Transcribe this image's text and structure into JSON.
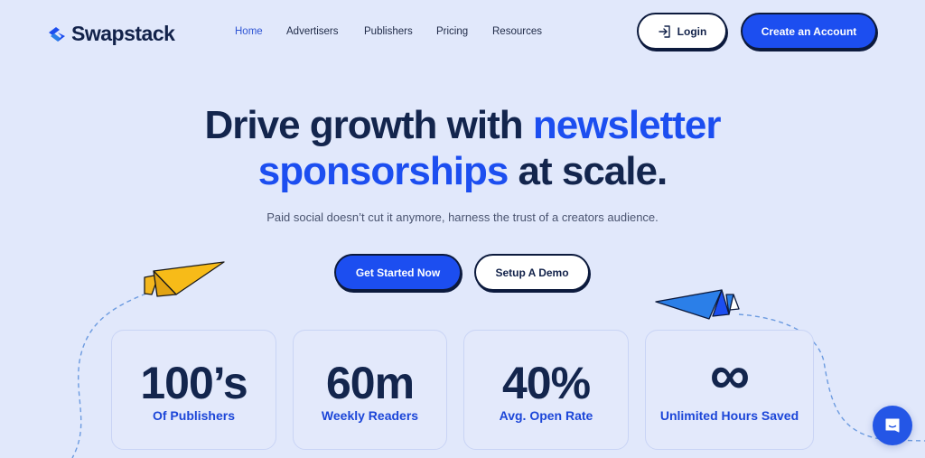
{
  "brand": {
    "name": "Swapstack",
    "accent": "#1c4ef0",
    "dark": "#13254d",
    "background": "#e1e8fb"
  },
  "nav": {
    "links": [
      {
        "label": "Home",
        "active": true
      },
      {
        "label": "Advertisers",
        "active": false
      },
      {
        "label": "Publishers",
        "active": false
      },
      {
        "label": "Pricing",
        "active": false
      },
      {
        "label": "Resources",
        "active": false
      }
    ],
    "login_label": "Login",
    "login_icon": "login-icon",
    "create_account_label": "Create an Account"
  },
  "hero": {
    "title_part1": "Drive growth with ",
    "title_accent1": "newsletter",
    "title_accent2": "sponsorships",
    "title_part2": " at scale.",
    "subtitle": "Paid social doesn’t cut it anymore, harness the trust of a creators audience.",
    "primary_cta": "Get Started Now",
    "secondary_cta": "Setup A Demo"
  },
  "stats": [
    {
      "value": "100’s",
      "label": "Of Publishers"
    },
    {
      "value": "60m",
      "label": "Weekly Readers"
    },
    {
      "value": "40%",
      "label": "Avg. Open Rate"
    },
    {
      "value": "∞",
      "label": "Unlimited Hours Saved"
    }
  ],
  "decorations": {
    "left_plane": "yellow-paper-plane-icon",
    "right_plane": "blue-paper-plane-icon"
  },
  "chat": {
    "icon": "chat-icon"
  }
}
